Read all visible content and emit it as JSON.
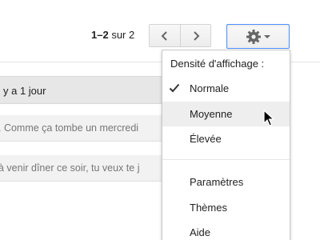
{
  "toolbar": {
    "pager_range": "1–2",
    "pager_rest": " sur 2",
    "older_icon": "chevron-left-icon",
    "newer_icon": "chevron-right-icon",
    "settings_icon": "gear-icon"
  },
  "list": {
    "section_header": "y a 1 jour",
    "rows": [
      {
        "snippet": ". Comme ça tombe un mercredi"
      },
      {
        "snippet": "à venir dîner ce soir, tu veux te j"
      }
    ]
  },
  "menu": {
    "heading": "Densité d'affichage :",
    "density": [
      {
        "label": "Normale",
        "checked": true
      },
      {
        "label": "Moyenne",
        "hovered": true
      },
      {
        "label": "Élevée"
      }
    ],
    "items": [
      {
        "label": "Paramètres"
      },
      {
        "label": "Thèmes"
      },
      {
        "label": "Aide"
      }
    ]
  },
  "colors": {
    "accent_border": "#4d90fe",
    "icon_gray": "#666666",
    "row_bg": "#f2f2f2"
  }
}
